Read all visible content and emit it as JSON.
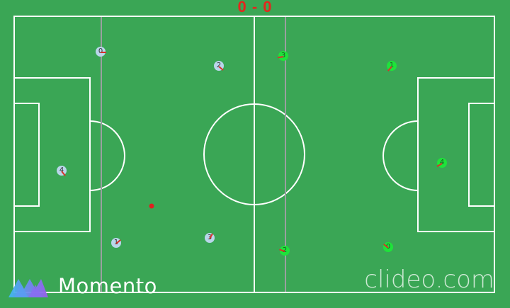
{
  "score": "0 - 0",
  "colors": {
    "pitch": "#3aa655",
    "lines": "#ffffff",
    "offside_lines": "#9aa0a0",
    "score": "#e4261d",
    "team_blue": "#b9d6ea",
    "team_green": "#1ee33a",
    "ball": "#e02020"
  },
  "team_blue": [
    {
      "label": "0"
    },
    {
      "label": "2"
    },
    {
      "label": "4"
    },
    {
      "label": "1"
    },
    {
      "label": "3"
    }
  ],
  "team_green": [
    {
      "label": "3"
    },
    {
      "label": "1"
    },
    {
      "label": "4"
    },
    {
      "label": "2"
    },
    {
      "label": "0"
    }
  ],
  "watermarks": {
    "left": "Momento",
    "right": "clideo.com"
  }
}
